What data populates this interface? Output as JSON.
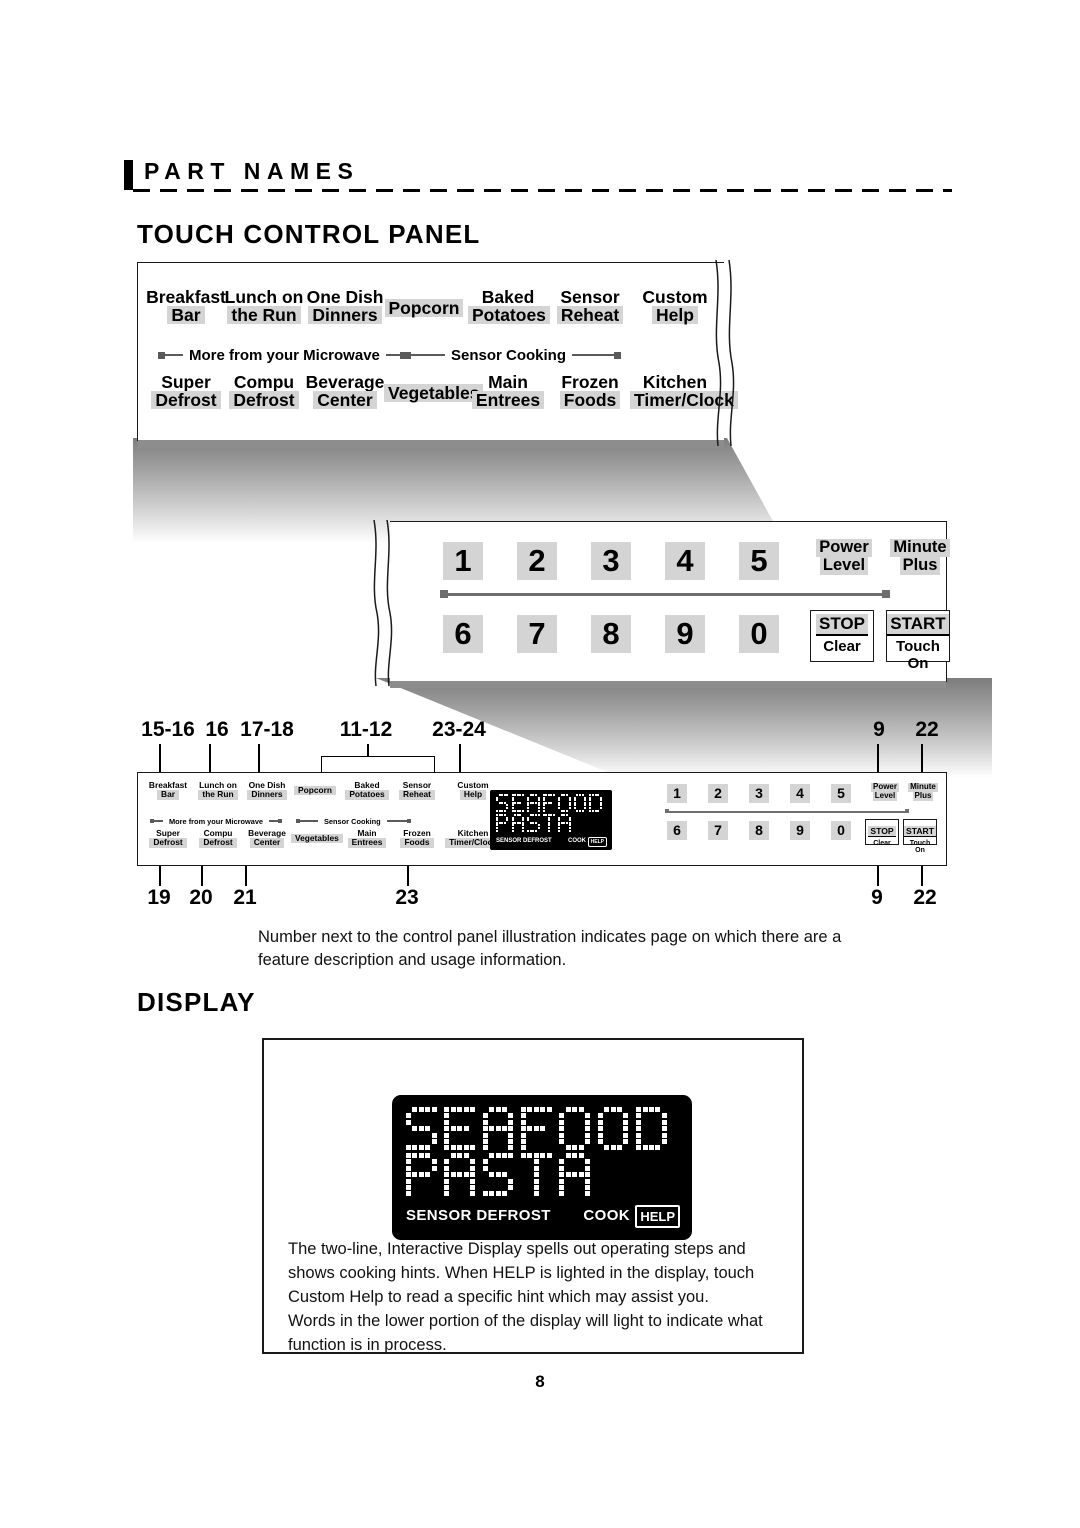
{
  "header": {
    "tag": "PART NAMES"
  },
  "headings": {
    "touch_control_panel": "TOUCH CONTROL PANEL",
    "display": "DISPLAY"
  },
  "control_panel": {
    "top_row_keys": [
      {
        "line1": "Breakfast",
        "line2": "Bar"
      },
      {
        "line1": "Lunch on",
        "line2": "the Run"
      },
      {
        "line1": "One Dish",
        "line2": "Dinners"
      },
      {
        "line1": "",
        "line2": "Popcorn"
      },
      {
        "line1": "Baked",
        "line2": "Potatoes"
      },
      {
        "line1": "Sensor",
        "line2": "Reheat"
      },
      {
        "line1": "Custom",
        "line2": "Help"
      }
    ],
    "group_labels": [
      {
        "text": "More from your Microwave"
      },
      {
        "text": "Sensor Cooking"
      }
    ],
    "bottom_row_keys": [
      {
        "line1": "Super",
        "line2": "Defrost"
      },
      {
        "line1": "Compu",
        "line2": "Defrost"
      },
      {
        "line1": "Beverage",
        "line2": "Center"
      },
      {
        "line1": "",
        "line2": "Vegetables"
      },
      {
        "line1": "Main",
        "line2": "Entrees"
      },
      {
        "line1": "Frozen",
        "line2": "Foods"
      },
      {
        "line1": "Kitchen",
        "line2": "Timer/Clock"
      }
    ]
  },
  "keypad": {
    "row1_digits": [
      "1",
      "2",
      "3",
      "4",
      "5"
    ],
    "row2_digits": [
      "6",
      "7",
      "8",
      "9",
      "0"
    ],
    "power_level": {
      "line1": "Power",
      "line2": "Level"
    },
    "minute_plus": {
      "line1": "Minute",
      "line2": "Plus"
    },
    "stop": {
      "top": "STOP",
      "bottom": "Clear"
    },
    "start": {
      "top": "START",
      "bottom": "Touch On"
    }
  },
  "reference_numbers": {
    "top": [
      "15-16",
      "16",
      "17-18",
      "11-12",
      "23-24",
      "9",
      "22"
    ],
    "bottom": [
      "19",
      "20",
      "21",
      "23",
      "9",
      "22"
    ]
  },
  "lcd": {
    "line1": "SEAFOOD",
    "line2": "PASTA",
    "status_left": "SENSOR DEFROST",
    "status_right": "COOK",
    "help_badge": "HELP"
  },
  "caption": "Number next to the control panel illustration indicates page on which there are a feature description and usage information.",
  "display_description": "The two-line, Interactive Display spells out operating steps and shows cooking hints. When HELP is lighted in the display, touch Custom Help to read a specific hint which may assist you.\nWords in the lower portion of the display will light to indicate what function is in process.",
  "page_number": "8",
  "colors": {
    "key_gray": "#d4d4d4",
    "rule_gray": "#6e6e6e",
    "ink": "#000000"
  }
}
